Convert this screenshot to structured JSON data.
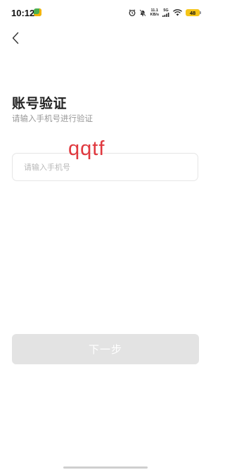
{
  "status_bar": {
    "time": "10:12",
    "net_speed_value": "11.1",
    "net_speed_unit": "KB/s",
    "network_type": "5G",
    "battery_level": "48",
    "icons": [
      "app-notification-icon",
      "alarm-icon",
      "mute-icon",
      "signal-icon",
      "wifi-icon",
      "battery-icon"
    ]
  },
  "header": {
    "back_icon": "chevron-left-icon"
  },
  "page": {
    "title": "账号验证",
    "subtitle": "请输入手机号进行验证"
  },
  "form": {
    "phone_placeholder": "请输入手机号",
    "phone_value": ""
  },
  "overlay": {
    "text": "qqtf",
    "color": "#e0383e"
  },
  "actions": {
    "next_label": "下一步",
    "next_enabled": false
  }
}
